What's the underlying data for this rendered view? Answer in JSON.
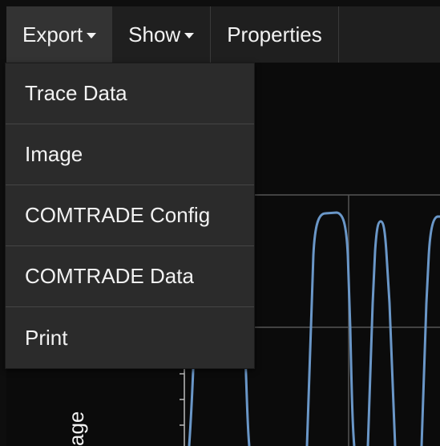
{
  "toolbar": {
    "export_label": "Export",
    "show_label": "Show",
    "properties_label": "Properties"
  },
  "export_menu": {
    "items": [
      {
        "label": "Trace Data"
      },
      {
        "label": "Image"
      },
      {
        "label": "COMTRADE Config"
      },
      {
        "label": "COMTRADE Data"
      },
      {
        "label": "Print"
      }
    ]
  },
  "plot": {
    "ylabel_visible": "age",
    "trace_color": "#6a97c8",
    "grid_color": "#555555"
  }
}
